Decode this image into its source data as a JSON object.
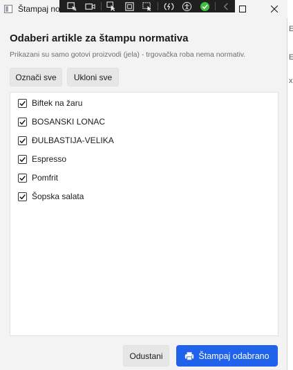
{
  "window": {
    "title": "Štampaj normative",
    "title_visible": "Štampaj no",
    "controls": {
      "minimize_icon": "minimize-icon",
      "maximize_icon": "maximize-icon",
      "close_icon": "close-icon"
    }
  },
  "debug_toolbar": {
    "tools": [
      {
        "name": "select-element-icon"
      },
      {
        "name": "video-icon"
      },
      {
        "name": "pointer-icon"
      },
      {
        "name": "layout-bounds-icon"
      },
      {
        "name": "select-pointer-icon"
      },
      {
        "name": "hot-reload-icon"
      },
      {
        "name": "accessibility-icon"
      },
      {
        "name": "check-status-icon"
      },
      {
        "name": "collapse-chevron-icon"
      }
    ]
  },
  "dialog": {
    "heading": "Odaberi artikle za štampu normativa",
    "subtitle": "Prikazani su samo gotovi proizvodi (jela) - trgovačka roba nema normativ.",
    "select_all_label": "Označi sve",
    "clear_all_label": "Ukloni sve",
    "items": [
      {
        "label": "Biftek na žaru",
        "checked": true
      },
      {
        "label": "BOSANSKI LONAC",
        "checked": true
      },
      {
        "label": "ĐULBASTIJA-VELIKA",
        "checked": true
      },
      {
        "label": "Espresso",
        "checked": true
      },
      {
        "label": "Pomfrit",
        "checked": true
      },
      {
        "label": "Šopska salata",
        "checked": true
      }
    ],
    "cancel_label": "Odustani",
    "print_label": "Štampaj odabrano",
    "print_icon": "printer-icon"
  },
  "colors": {
    "accent": "#1e63e9",
    "window_bg": "#f3f3f3",
    "list_bg": "#ffffff",
    "button_bg": "#e6e6e6"
  }
}
